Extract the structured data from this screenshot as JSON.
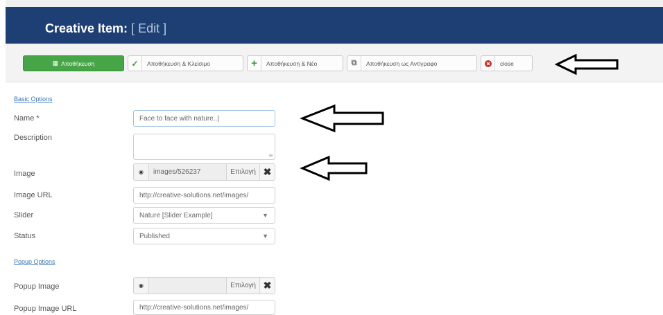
{
  "header": {
    "title": "Creative Item:",
    "subtitle": "[ Edit ]"
  },
  "toolbar": {
    "save": "Αποθήκευση",
    "save_close": "Αποθήκευση & Κλείσιμο",
    "save_new": "Αποθήκευση & Νέο",
    "save_copy": "Αποθήκευση ως Αντίγραφο",
    "close": "close"
  },
  "form": {
    "basic_options": "Basic Options",
    "name_label": "Name *",
    "name_value": "Face to face with nature..|",
    "description_label": "Description",
    "image_label": "Image",
    "image_path": "images/526237",
    "image_choose": "Επιλογή",
    "image_url_label": "Image URL",
    "image_url_value": "http://creative-solutions.net/images/",
    "slider_label": "Slider",
    "slider_value": "Nature [Slider Example]",
    "status_label": "Status",
    "status_value": "Published",
    "popup_options": "Popup Options",
    "popup_image_label": "Popup Image",
    "popup_image_path": "",
    "popup_image_choose": "Επιλογή",
    "popup_image_url_label": "Popup Image URL",
    "popup_image_url_value": "http://creative-solutions.net/images/"
  },
  "colors": {
    "header": "#1d3f73",
    "save_button": "#46a546",
    "link": "#3a78b8"
  },
  "icons": {
    "save": "save-icon",
    "check": "check-icon",
    "plus": "plus-icon",
    "copy": "copy-icon",
    "close": "close-circle-icon",
    "preview": "eye-icon",
    "clear": "clear-x-icon",
    "annotation": "left-arrow-icon"
  }
}
